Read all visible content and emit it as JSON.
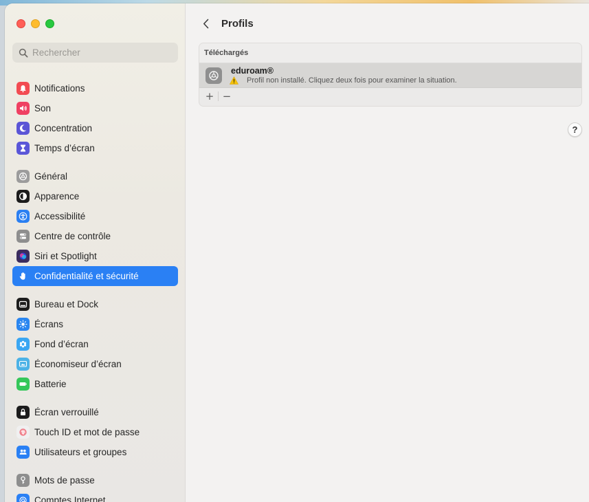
{
  "search": {
    "placeholder": "Rechercher"
  },
  "sidebar": {
    "groups": [
      [
        {
          "label": "Notifications",
          "icon": "bell-icon",
          "color": "#f24b52"
        },
        {
          "label": "Son",
          "icon": "speaker-icon",
          "color": "#ef4062"
        },
        {
          "label": "Concentration",
          "icon": "moon-icon",
          "color": "#5b55d6"
        },
        {
          "label": "Temps d’écran",
          "icon": "hourglass-icon",
          "color": "#5a56d8"
        }
      ],
      [
        {
          "label": "Général",
          "icon": "gear-icon",
          "color": "#9c9c9c"
        },
        {
          "label": "Apparence",
          "icon": "appearance-icon",
          "color": "#1c1c1c"
        },
        {
          "label": "Accessibilité",
          "icon": "accessibility-icon",
          "color": "#2a7ff2"
        },
        {
          "label": "Centre de contrôle",
          "icon": "control-center-icon",
          "color": "#8e8e8e"
        },
        {
          "label": "Siri et Spotlight",
          "icon": "siri-icon",
          "color": "#3b2c5e"
        },
        {
          "label": "Confidentialité et sécurité",
          "icon": "hand-icon",
          "color": "#2a80f4",
          "active": true
        }
      ],
      [
        {
          "label": "Bureau et Dock",
          "icon": "dock-icon",
          "color": "#1c1c1c"
        },
        {
          "label": "Écrans",
          "icon": "sun-icon",
          "color": "#2a86f0"
        },
        {
          "label": "Fond d’écran",
          "icon": "wallpaper-icon",
          "color": "#3aa6f2"
        },
        {
          "label": "Économiseur d’écran",
          "icon": "screensaver-icon",
          "color": "#4bb2e6"
        },
        {
          "label": "Batterie",
          "icon": "battery-icon",
          "color": "#34c759"
        }
      ],
      [
        {
          "label": "Écran verrouillé",
          "icon": "lock-icon",
          "color": "#1c1c1c"
        },
        {
          "label": "Touch ID et mot de passe",
          "icon": "fingerprint-icon",
          "color": "#f0f0f0"
        },
        {
          "label": "Utilisateurs et groupes",
          "icon": "users-icon",
          "color": "#2a80f4"
        }
      ],
      [
        {
          "label": "Mots de passe",
          "icon": "key-icon",
          "color": "#8e8e8e"
        },
        {
          "label": "Comptes Internet",
          "icon": "at-icon",
          "color": "#2a80f4"
        }
      ]
    ]
  },
  "main": {
    "title": "Profils",
    "section_label": "Téléchargés",
    "profile": {
      "name": "eduroam®",
      "status": "Profil non installé. Cliquez deux fois pour examiner la situation."
    },
    "add_label": "+",
    "remove_label": "−",
    "help_label": "?"
  }
}
